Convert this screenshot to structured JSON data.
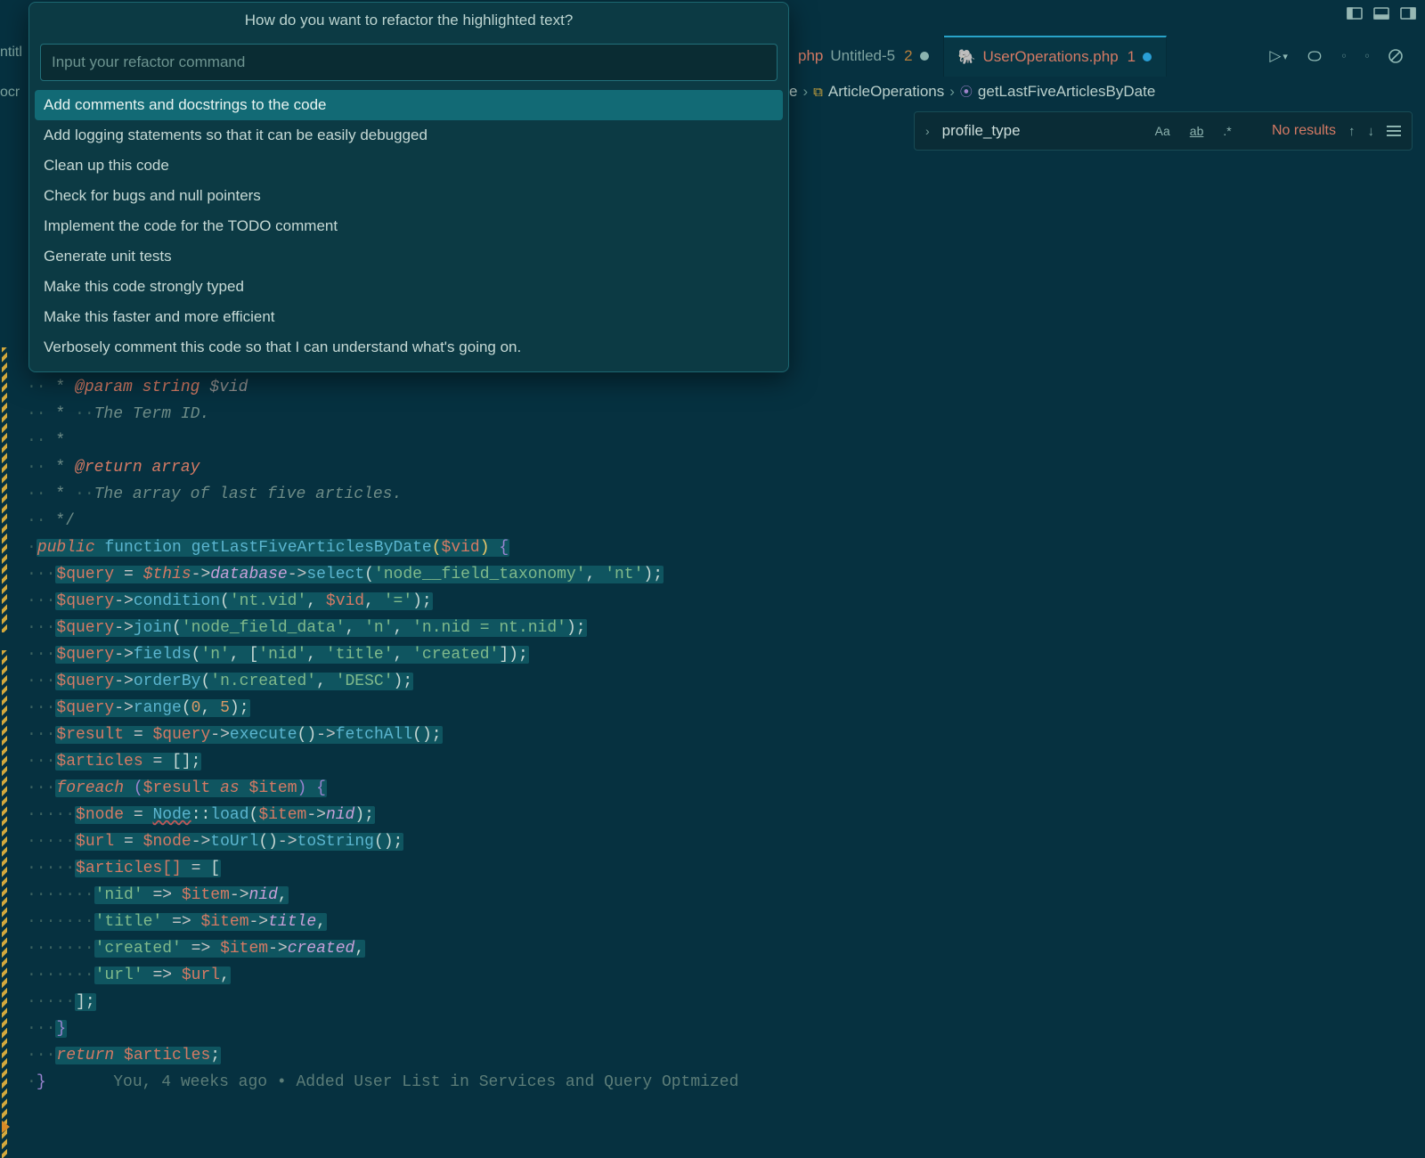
{
  "titlebar": {
    "icons": [
      "panel-left",
      "panel-bottom",
      "panel-right"
    ]
  },
  "tabs": {
    "partial_left": "ntitl",
    "second_visible": {
      "suffix": "php",
      "name": "Untitled-5",
      "num": "2"
    },
    "active": {
      "icon": "php",
      "name": "UserOperations.php",
      "num": "1"
    }
  },
  "breadcrumbs": {
    "partial": "e",
    "class": "ArticleOperations",
    "method": "getLastFiveArticlesByDate"
  },
  "left_labels": {
    "l1": "ntitl",
    "l2": "ocr"
  },
  "findbar": {
    "value": "profile_type",
    "opts": [
      "Aa",
      "ab",
      ".*"
    ],
    "results": "No results"
  },
  "popup": {
    "title": "How do you want to refactor the highlighted text?",
    "placeholder": "Input your refactor command",
    "items": [
      "Add comments and docstrings to the code",
      "Add logging statements so that it can be easily debugged",
      "Clean up this code",
      "Check for bugs and null pointers",
      "Implement the code for the TODO comment",
      "Generate unit tests",
      "Make this code strongly typed",
      "Make this faster and more efficient",
      "Verbosely comment this code so that I can understand what's going on."
    ],
    "selected_index": 0
  },
  "code": {
    "doc_param_tag": "@param",
    "doc_param_type": "string",
    "doc_param_var": "$vid",
    "doc_param_desc": "The Term ID.",
    "doc_return_tag": "@return",
    "doc_return_type": "array",
    "doc_return_desc": "The array of last five articles.",
    "visibility": "public",
    "fn_kw": "function",
    "fn_name": "getLastFiveArticlesByDate",
    "param": "$vid",
    "l1": {
      "v": "$query",
      "m": "select",
      "a1": "'node__field_taxonomy'",
      "a2": "'nt'"
    },
    "l2": {
      "m": "condition",
      "a1": "'nt.vid'",
      "a2": "$vid",
      "a3": "'='"
    },
    "l3": {
      "m": "join",
      "a1": "'node_field_data'",
      "a2": "'n'",
      "a3": "'n.nid = nt.nid'"
    },
    "l4": {
      "m": "fields",
      "a1": "'n'",
      "arr": [
        "'nid'",
        "'title'",
        "'created'"
      ]
    },
    "l5": {
      "m": "orderBy",
      "a1": "'n.created'",
      "a2": "'DESC'"
    },
    "l6": {
      "m": "range",
      "a1": "0",
      "a2": "5"
    },
    "l7": {
      "v": "$result",
      "m1": "execute",
      "m2": "fetchAll"
    },
    "l8": {
      "v": "$articles"
    },
    "foreach": {
      "kw": "foreach",
      "iter": "$result",
      "as": "as",
      "item": "$item"
    },
    "n1": {
      "v": "$node",
      "cls": "Node",
      "m": "load",
      "arg": "$item",
      "p": "nid"
    },
    "n2": {
      "v": "$url",
      "src": "$node",
      "m1": "toUrl",
      "m2": "toString"
    },
    "n3": {
      "v": "$articles[]"
    },
    "kv": [
      {
        "k": "'nid'",
        "src": "$item",
        "p": "nid"
      },
      {
        "k": "'title'",
        "src": "$item",
        "p": "title"
      },
      {
        "k": "'created'",
        "src": "$item",
        "p": "created"
      },
      {
        "k": "'url'",
        "v": "$url"
      }
    ],
    "ret": {
      "kw": "return",
      "v": "$articles"
    },
    "blame": "You, 4 weeks ago • Added User List in Services and Query Optmized"
  }
}
